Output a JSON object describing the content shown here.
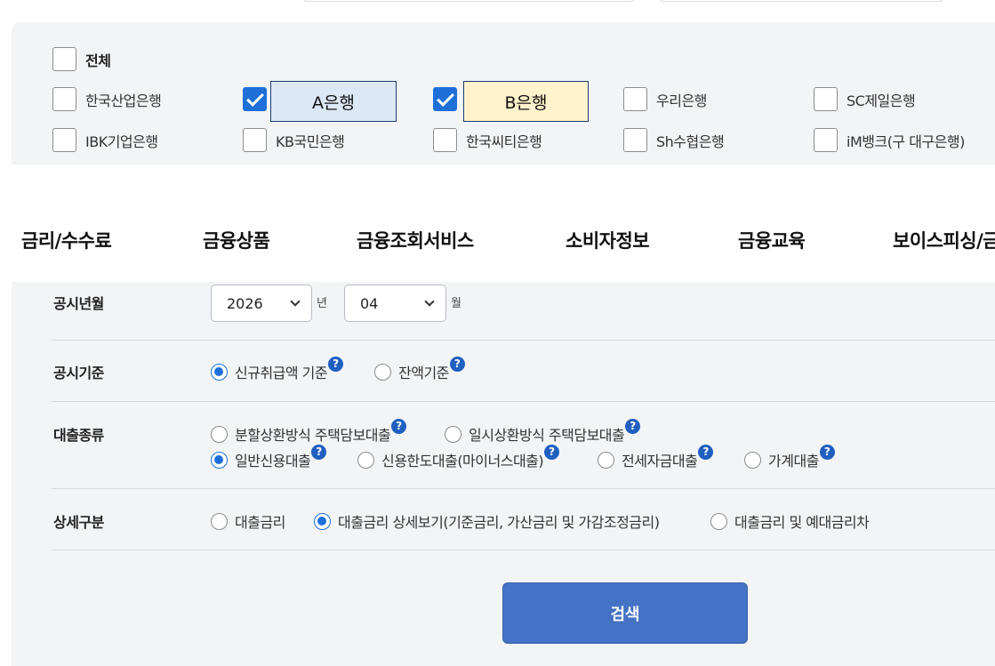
{
  "banks": {
    "all_label": "전체",
    "items": [
      {
        "label": "한국산업은행",
        "checked": false
      },
      {
        "label": "",
        "checked": true,
        "tag": "A은행",
        "tag_color": "#dde8f6"
      },
      {
        "label": "",
        "checked": true,
        "tag": "B은행",
        "tag_color": "#fff2cc"
      },
      {
        "label": "우리은행",
        "checked": false
      },
      {
        "label": "SC제일은행",
        "checked": false
      },
      {
        "label": "IBK기업은행",
        "checked": false
      },
      {
        "label": "KB국민은행",
        "checked": false
      },
      {
        "label": "한국씨티은행",
        "checked": false
      },
      {
        "label": "Sh수협은행",
        "checked": false
      },
      {
        "label": "iM뱅크(구 대구은행)",
        "checked": false
      }
    ]
  },
  "nav": [
    "금리/수수료",
    "금융상품",
    "금융조회서비스",
    "소비자정보",
    "금융교육",
    "보이스피싱/금"
  ],
  "form": {
    "period": {
      "label": "공시년월",
      "year": "2026",
      "year_unit": "년",
      "month": "04",
      "month_unit": "월"
    },
    "basis": {
      "label": "공시기준",
      "options": [
        {
          "label": "신규취급액 기준",
          "selected": true,
          "help": "?"
        },
        {
          "label": "잔액기준",
          "selected": false,
          "help": "?"
        }
      ]
    },
    "loan_type": {
      "label": "대출종류",
      "options": [
        {
          "label": "분할상환방식 주택담보대출",
          "selected": false,
          "help": "?"
        },
        {
          "label": "일시상환방식 주택담보대출",
          "selected": false,
          "help": "?"
        },
        {
          "label": "일반신용대출",
          "selected": true,
          "help": "?"
        },
        {
          "label": "신용한도대출(마이너스대출)",
          "selected": false,
          "help": "?"
        },
        {
          "label": "전세자금대출",
          "selected": false,
          "help": "?"
        },
        {
          "label": "가계대출",
          "selected": false,
          "help": "?"
        }
      ]
    },
    "detail": {
      "label": "상세구분",
      "options": [
        {
          "label": "대출금리",
          "selected": false
        },
        {
          "label": "대출금리 상세보기(기준금리, 가산금리 및 가감조정금리)",
          "selected": true
        },
        {
          "label": "대출금리 및 예대금리차",
          "selected": false
        }
      ]
    },
    "search_label": "검색"
  },
  "colors": {
    "accent": "#1f6fd8",
    "button": "#4472c4",
    "panel": "#f3f4f6"
  }
}
